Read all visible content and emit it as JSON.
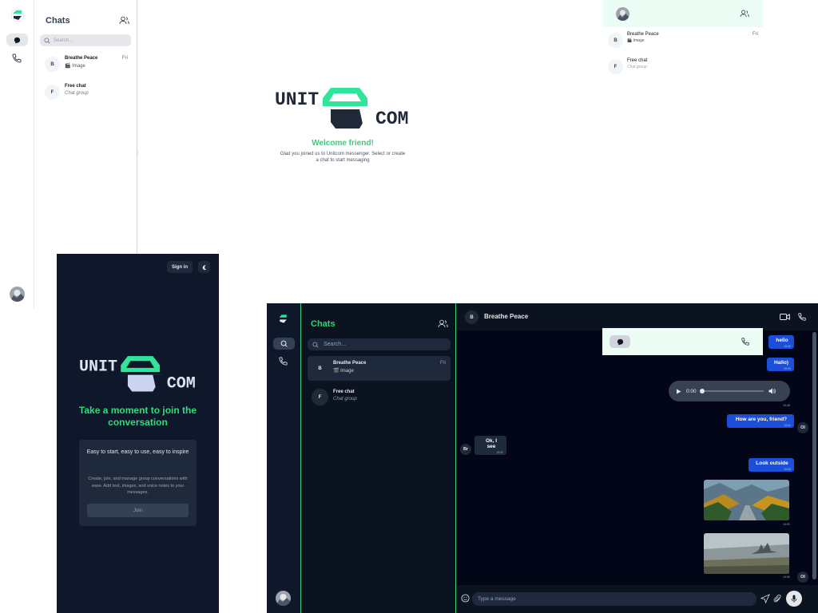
{
  "brand": {
    "logo_name": "UNITCOM",
    "accent": "#34d27a",
    "mark_green": "#2fe59a",
    "mark_dark": "#1f2937",
    "logo_word_1": "UNIT",
    "logo_word_2": "COM"
  },
  "light_app": {
    "sidebar_title": "Chats",
    "search_placeholder": "Search...",
    "chats": [
      {
        "initial": "B",
        "name": "Breathe Peace",
        "preview": "🎬 Image",
        "date": "Fri"
      },
      {
        "initial": "F",
        "name": "Free chat",
        "preview": "Chat group",
        "date": ""
      }
    ],
    "welcome_heading": "Welcome friend!",
    "welcome_text": "Glad you joined us to Unitcom messenger. Select or create a chat to start messaging"
  },
  "light_mobile": {
    "chats": [
      {
        "initial": "B",
        "name": "Breathe Peace",
        "preview": "🎬 Image",
        "date": "Fri"
      },
      {
        "initial": "F",
        "name": "Free chat",
        "preview": "Chat group",
        "date": ""
      }
    ]
  },
  "dark_mobile": {
    "signin_label": "Sign in",
    "heading": "Take a moment to join the conversation",
    "card_title": "Easy to start, easy to use, easy to inspire",
    "card_text": "Create, join, and manage group conversations with ease. Add text, images, and voice notes to your messages.",
    "join_label": "Join"
  },
  "dark_app": {
    "sidebar_title": "Chats",
    "search_placeholder": "Search...",
    "chats": [
      {
        "initial": "B",
        "name": "Breathe Peace",
        "preview": "🎬 Image",
        "date": "Fri",
        "selected": true
      },
      {
        "initial": "F",
        "name": "Free chat",
        "preview": "Chat group",
        "date": "",
        "selected": false
      }
    ],
    "chat_header": {
      "initial": "B",
      "name": "Breathe Peace"
    },
    "messages": {
      "m1": {
        "text": "hello",
        "time": "15:50"
      },
      "m2": {
        "text": "Hallo)",
        "time": "15:50"
      },
      "audio": {
        "time_display": "0:00",
        "stamp": "15:48",
        "progress": 0
      },
      "m3": {
        "text": "How are you, friend?",
        "time": "15:51",
        "avatar": "OI"
      },
      "m4": {
        "text": "Ok, I see",
        "time": "15:52",
        "avatar": "Br"
      },
      "m5": {
        "text": "Look outside",
        "time": "15:53"
      },
      "img1_stamp": "15:53",
      "img2_stamp": "15:55",
      "img2_avatar": "OI"
    },
    "composer_placeholder": "Type a message"
  }
}
